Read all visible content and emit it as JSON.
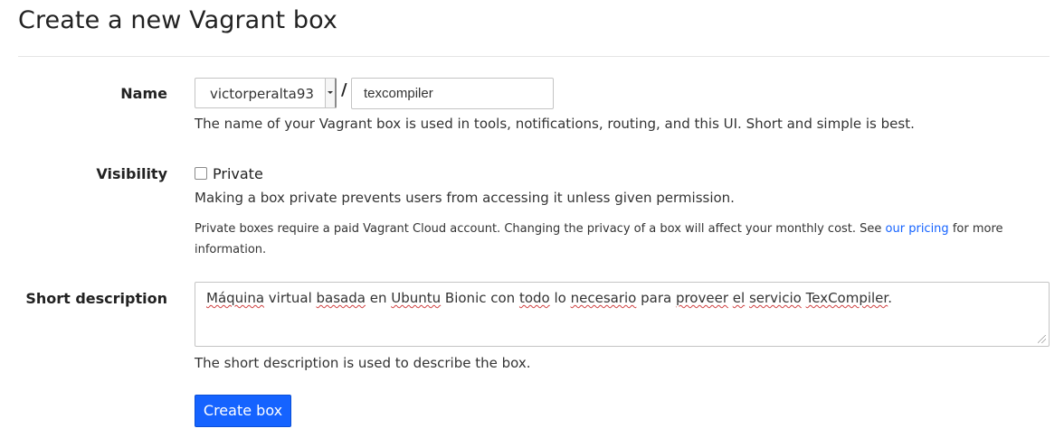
{
  "page": {
    "title": "Create a new Vagrant box"
  },
  "form": {
    "name": {
      "label": "Name",
      "owner_value": "victorperalta93",
      "separator": "/",
      "box_name_value": "texcompiler",
      "help": "The name of your Vagrant box is used in tools, notifications, routing, and this UI. Short and simple is best."
    },
    "visibility": {
      "label": "Visibility",
      "checkbox_label": "Private",
      "checked": false,
      "help": "Making a box private prevents users from accessing it unless given permission.",
      "note_before_link": "Private boxes require a paid Vagrant Cloud account. Changing the privacy of a box will affect your monthly cost. See ",
      "link_text": "our pricing",
      "note_after_link": " for more information."
    },
    "short_description": {
      "label": "Short description",
      "value_words": [
        {
          "text": "Máquina",
          "spell": true
        },
        {
          "text": " virtual ",
          "spell": false
        },
        {
          "text": "basada",
          "spell": true
        },
        {
          "text": " en ",
          "spell": false
        },
        {
          "text": "Ubuntu",
          "spell": true
        },
        {
          "text": " Bionic con ",
          "spell": false
        },
        {
          "text": "todo",
          "spell": true
        },
        {
          "text": " lo ",
          "spell": false
        },
        {
          "text": "necesario",
          "spell": true
        },
        {
          "text": " para ",
          "spell": false
        },
        {
          "text": "proveer",
          "spell": true
        },
        {
          "text": " ",
          "spell": false
        },
        {
          "text": "el",
          "spell": true
        },
        {
          "text": " ",
          "spell": false
        },
        {
          "text": "servicio",
          "spell": true
        },
        {
          "text": " ",
          "spell": false
        },
        {
          "text": "TexCompiler",
          "spell": true
        },
        {
          "text": ".",
          "spell": false
        }
      ],
      "help": "The short description is used to describe the box."
    },
    "submit_label": "Create box"
  },
  "colors": {
    "primary": "#1563ff",
    "link": "#1563ff",
    "text": "#222222",
    "divider": "#e4e4e4"
  }
}
